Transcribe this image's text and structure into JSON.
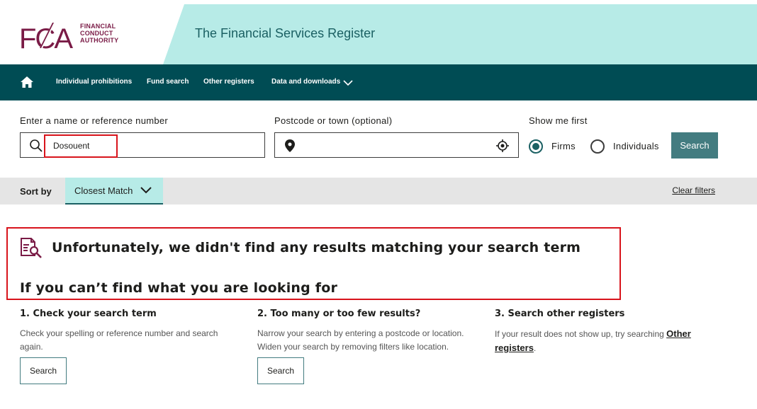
{
  "brand": {
    "logo_letters": "FCA",
    "logo_lines": [
      "FINANCIAL",
      "CONDUCT",
      "AUTHORITY"
    ],
    "site_title": "The Financial Services Register",
    "brand_color": "#7a1b46",
    "accent_color": "#b7ebe7",
    "nav_color": "#004c54"
  },
  "nav": {
    "home_icon": "home-icon",
    "items": [
      {
        "label": "Individual prohibitions"
      },
      {
        "label": "Fund search"
      },
      {
        "label": "Other registers"
      },
      {
        "label": "Data and downloads"
      }
    ]
  },
  "search": {
    "name_label": "Enter a name or reference number",
    "name_value": "Dosouent",
    "location_label": "Postcode or town (optional)",
    "location_value": "",
    "show_first_label": "Show me first",
    "options": [
      {
        "label": "Firms",
        "selected": true
      },
      {
        "label": "Individuals",
        "selected": false
      }
    ],
    "button_label": "Search"
  },
  "sort": {
    "label": "Sort by",
    "selected": "Closest Match",
    "clear_label": "Clear filters"
  },
  "results": {
    "no_results_title": "Unfortunately, we didn't find any results matching your search term",
    "help_title": "If you can’t find what you are looking for",
    "tips": [
      {
        "title": "1. Check your search term",
        "body": "Check your spelling or reference number and search again.",
        "button_label": "Search"
      },
      {
        "title": "2. Too many or too few results?",
        "body": "Narrow your search by entering a postcode or location. Widen your search by removing filters like location.",
        "button_label": "Search"
      },
      {
        "title": "3. Search other registers",
        "body_prefix": "If your result does not show up, try searching ",
        "link_label": "Other registers",
        "body_suffix": "."
      }
    ]
  },
  "annotation_color": "#d8141c"
}
